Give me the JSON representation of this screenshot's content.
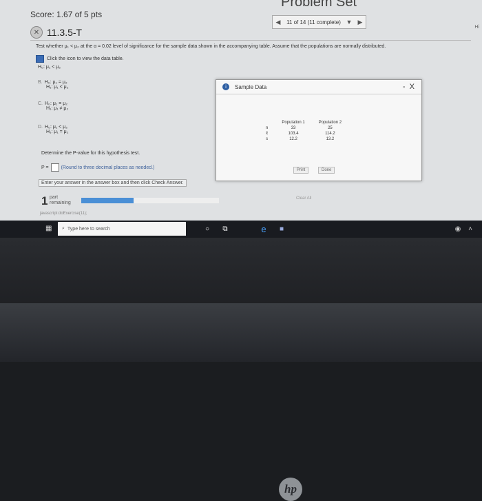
{
  "header": {
    "title": "Problem Set",
    "score": "Score: 1.67 of 5 pts",
    "question_id": "11.3.5-T",
    "nav": {
      "prev": "◀",
      "position": "11 of 14 (11 complete)",
      "dropdown": "▼",
      "next": "▶"
    },
    "help_label": "Hi"
  },
  "question": {
    "prompt": "Test whether μ₁ < μ₂ at the α = 0.02 level of significance for the sample data shown in the accompanying table. Assume that the populations are normally distributed.",
    "icon_text": "Click the icon to view the data table.",
    "hypotheses": [
      {
        "option": "",
        "h0": "H₀: μ₁ < μ₂",
        "h1": ""
      },
      {
        "option": "B.",
        "h0": "H₀: μ₁ = μ₂",
        "h1": "H₁: μ₁ < μ₂"
      },
      {
        "option": "C.",
        "h0": "H₀: μ₁ = μ₂",
        "h1": "H₁: μ₁ ≠ μ₂"
      },
      {
        "option": "D.",
        "h0": "H₀: μ₁ < μ₂",
        "h1": "H₁: μ₁ = μ₂"
      }
    ],
    "pvalue_question": "Determine the P-value for this hypothesis test.",
    "pvalue_label": "P =",
    "pvalue_value": "",
    "pvalue_hint": "(Round to three decimal places as needed.)",
    "instruction": "Enter your answer in the answer box and then click Check Answer."
  },
  "footer": {
    "parts_count": "1",
    "parts_text_1": "part",
    "parts_text_2": "remaining",
    "progress": 0.38,
    "clear_all": "Clear All",
    "status_link": "javascript:doExercise(11);"
  },
  "taskbar": {
    "search_placeholder": "Type here to search",
    "icons": [
      "windows-icon",
      "cortana-icon",
      "task-view-icon",
      "edge-icon",
      "store-icon"
    ]
  },
  "modal": {
    "title": "Sample Data",
    "minimize": "-",
    "close": "X",
    "columns": [
      "",
      "Population 1",
      "Population 2"
    ],
    "rows": [
      {
        "label": "n",
        "p1": "33",
        "p2": "25"
      },
      {
        "label": "x̄",
        "p1": "103.4",
        "p2": "114.2"
      },
      {
        "label": "s",
        "p1": "12.2",
        "p2": "13.2"
      }
    ],
    "print_label": "Print",
    "done_label": "Done"
  },
  "device": {
    "logo": "hp"
  },
  "colors": {
    "accent": "#2e5fa3",
    "progress": "#4a8fd6"
  }
}
